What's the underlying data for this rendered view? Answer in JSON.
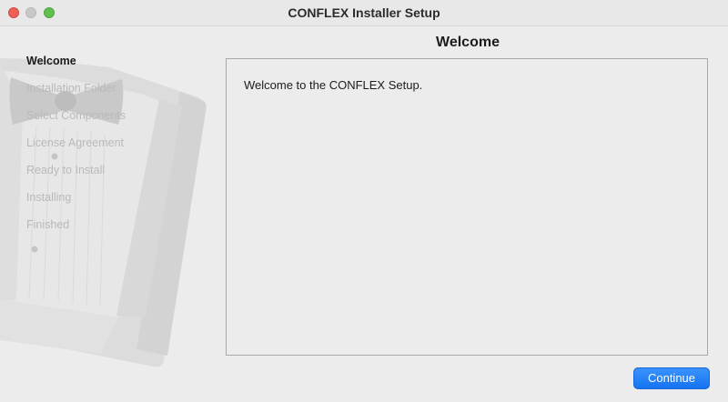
{
  "window": {
    "title": "CONFLEX Installer Setup"
  },
  "sidebar": {
    "steps": [
      {
        "label": "Welcome",
        "active": true
      },
      {
        "label": "Installation Folder",
        "active": false
      },
      {
        "label": "Select Components",
        "active": false
      },
      {
        "label": "License Agreement",
        "active": false
      },
      {
        "label": "Ready to Install",
        "active": false
      },
      {
        "label": "Installing",
        "active": false
      },
      {
        "label": "Finished",
        "active": false
      }
    ]
  },
  "page": {
    "heading": "Welcome",
    "body_text": "Welcome to the CONFLEX Setup."
  },
  "buttons": {
    "continue_label": "Continue"
  },
  "colors": {
    "accent": "#1673f0",
    "close": "#ee5f57",
    "maximize": "#5fc04e",
    "minimize_inactive": "#c8c8c8"
  }
}
